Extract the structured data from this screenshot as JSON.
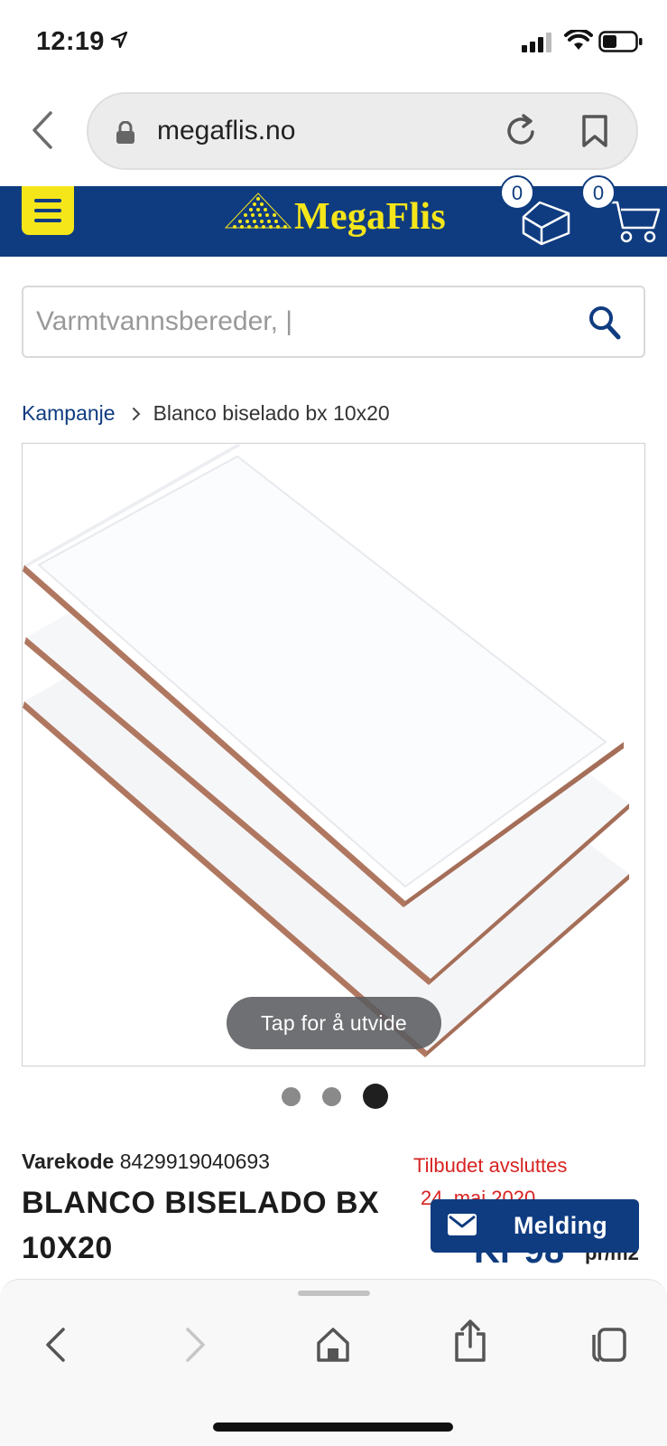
{
  "status_bar": {
    "time": "12:19"
  },
  "browser": {
    "url": "megaflis.no",
    "icons": [
      "back-chevron-icon",
      "lock-icon",
      "reload-icon",
      "bookmark-icon"
    ]
  },
  "site_header": {
    "logo_text": "MegaFlis",
    "wishlist_count": "0",
    "cart_count": "0",
    "colors": {
      "header_bg": "#0f3c80",
      "accent": "#f5e61a"
    }
  },
  "search": {
    "placeholder": "Varmtvannsbereder, |"
  },
  "breadcrumb": {
    "parent": "Kampanje",
    "current": "Blanco biselado bx 10x20"
  },
  "gallery": {
    "expand_hint": "Tap for å utvide",
    "slide_count": 3,
    "active_slide": 3
  },
  "product": {
    "code_label": "Varekode",
    "code": "8429919040693",
    "title": "BLANCO BISELADO BX 10X20",
    "offer_line1": "Tilbudet avsluttes",
    "offer_line2": "24. mai 2020",
    "price": "Kr 98",
    "unit": "pr/m2",
    "offer_color": "#d72321"
  },
  "chat": {
    "label": "Melding"
  },
  "toolbar": {
    "icons": [
      "back-icon",
      "forward-icon",
      "home-icon",
      "share-icon",
      "tabs-icon"
    ]
  }
}
